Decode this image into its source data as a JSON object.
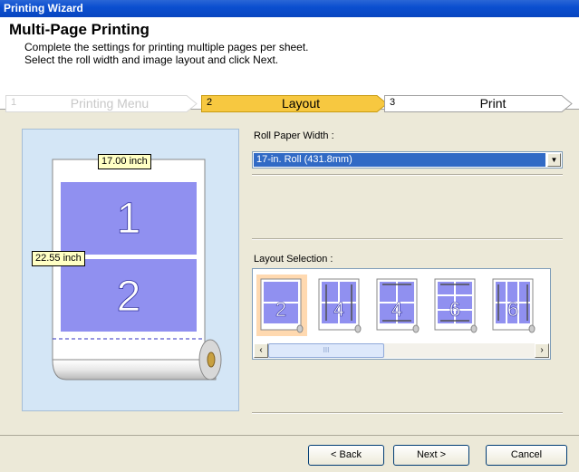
{
  "window": {
    "title": "Printing Wizard"
  },
  "header": {
    "title": "Multi-Page Printing",
    "line1": "Complete the settings for printing multiple pages per sheet.",
    "line2": "Select the roll width and image layout and click Next."
  },
  "steps": [
    {
      "num": "1",
      "label": "Printing Menu",
      "state": "disabled"
    },
    {
      "num": "2",
      "label": "Layout",
      "state": "active",
      "color": "#f7c840"
    },
    {
      "num": "3",
      "label": "Print",
      "state": "upcoming"
    }
  ],
  "preview": {
    "width_label": "17.00 inch",
    "height_label": "22.55 inch",
    "page1": "1",
    "page2": "2"
  },
  "roll_width": {
    "label": "Roll Paper Width :",
    "value": "17-in. Roll (431.8mm)"
  },
  "layout_selection": {
    "label": "Layout Selection :",
    "options": [
      {
        "pages": "2",
        "selected": true
      },
      {
        "pages": "4",
        "selected": false
      },
      {
        "pages": "4",
        "selected": false
      },
      {
        "pages": "6",
        "selected": false
      },
      {
        "pages": "6",
        "selected": false
      }
    ],
    "scroll_thumb": "III"
  },
  "buttons": {
    "back": "< Back",
    "next": "Next >",
    "cancel": "Cancel"
  },
  "colors": {
    "titlebar": "#0846c0",
    "page_fill": "#9090f0",
    "selected_text": "#316ac5"
  }
}
